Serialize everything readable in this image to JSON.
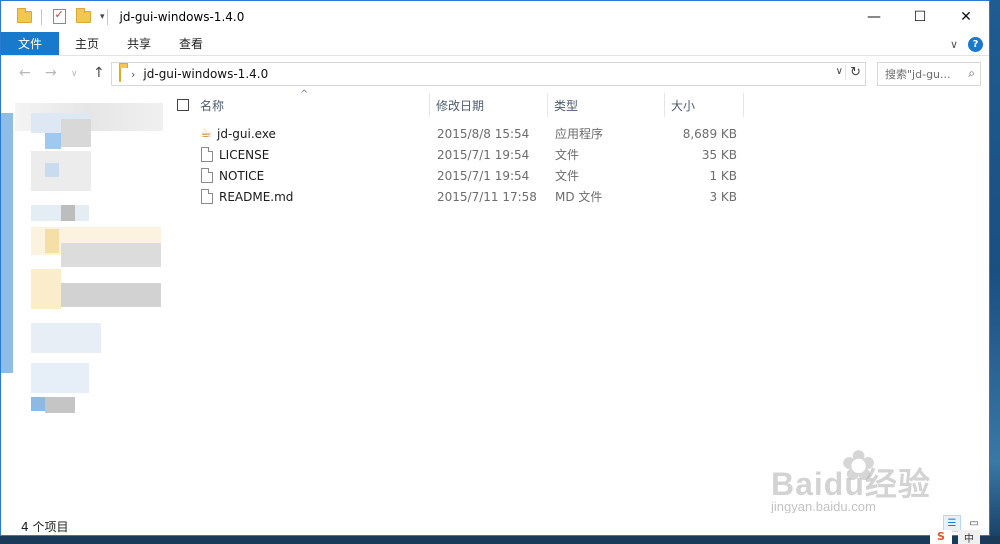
{
  "window": {
    "title": "jd-gui-windows-1.4.0",
    "controls": {
      "minimize": "—",
      "maximize": "☐",
      "close": "✕"
    }
  },
  "quick_access": {
    "dropdown": "▾"
  },
  "ribbon": {
    "tabs": [
      "文件",
      "主页",
      "共享",
      "查看"
    ],
    "expand": "∨",
    "help": "?"
  },
  "address": {
    "path": "jd-gui-windows-1.4.0",
    "separator": "›",
    "nav": {
      "back": "←",
      "forward": "→",
      "recent": "∨",
      "up": "↑"
    },
    "dropdown": "∨",
    "refresh": "↻"
  },
  "search": {
    "placeholder": "搜索\"jd-gu...",
    "icon": "search-icon"
  },
  "columns": {
    "name": "名称",
    "date": "修改日期",
    "type": "类型",
    "size": "大小",
    "sort_caret": "^"
  },
  "files": [
    {
      "name": "jd-gui.exe",
      "date": "2015/8/8 15:54",
      "type": "应用程序",
      "size": "8,689 KB",
      "icon": "exe-icon"
    },
    {
      "name": "LICENSE",
      "date": "2015/7/1 19:54",
      "type": "文件",
      "size": "35 KB",
      "icon": "file-icon"
    },
    {
      "name": "NOTICE",
      "date": "2015/7/1 19:54",
      "type": "文件",
      "size": "1 KB",
      "icon": "file-icon"
    },
    {
      "name": "README.md",
      "date": "2015/7/11 17:58",
      "type": "MD 文件",
      "size": "3 KB",
      "icon": "file-icon"
    }
  ],
  "status": {
    "item_count": "4 个项目"
  },
  "watermark": {
    "brand": "Baidu经验",
    "url": "jingyan.baidu.com"
  },
  "tray": {
    "ime": "中",
    "s": "S"
  },
  "colors": {
    "accent": "#1979ca",
    "folder": "#f3c64f",
    "border": "#2b79d3"
  }
}
